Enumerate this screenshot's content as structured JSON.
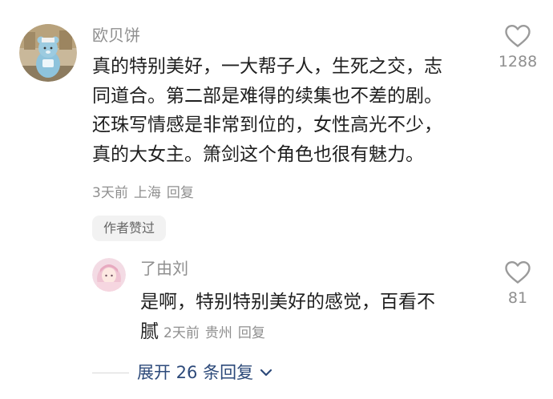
{
  "comment": {
    "username": "欧贝饼",
    "lines": [
      "真的特别美好，一大帮子人，生死之交，志",
      "同道合。第二部是难得的续集也不差的剧。",
      "还珠写情感是非常到位的，女性高光不少，",
      "真的大女主。箫剑这个角色也很有魅力。"
    ],
    "time": "3天前",
    "location": "上海",
    "reply_label": "回复",
    "badge": "作者赞过",
    "like_count": "1288",
    "like_icon": "heart-outline-icon"
  },
  "reply": {
    "username": "了由刘",
    "lines": [
      "是啊，特别特别美好的感觉，百看不",
      "腻"
    ],
    "time": "2天前",
    "location": "贵州",
    "reply_label": "回复",
    "like_count": "81",
    "like_icon": "heart-outline-icon"
  },
  "expand": {
    "label": "展开 26 条回复",
    "icon": "chevron-down-icon"
  },
  "colors": {
    "text": "#1f1f1f",
    "muted": "#8f8f8f",
    "link": "#2d4a7a",
    "badge_bg": "#f2f2f2"
  }
}
